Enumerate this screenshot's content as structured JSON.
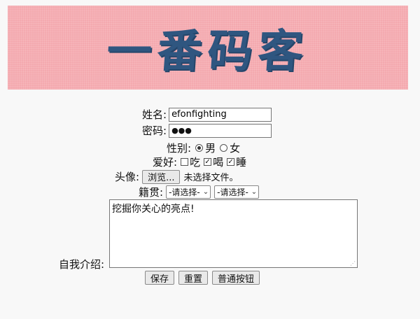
{
  "banner": {
    "title": "一番码客"
  },
  "form": {
    "name_label": "姓名:",
    "name_value": "efonfighting",
    "password_label": "密码:",
    "password_value": "●●●",
    "gender_label": "性别:",
    "gender_male": "男",
    "gender_female": "女",
    "hobby_label": "爱好:",
    "hobby_eat": "吃",
    "hobby_drink": "喝",
    "hobby_sleep": "睡",
    "avatar_label": "头像:",
    "browse_button": "浏览...",
    "no_file": "未选择文件。",
    "origin_label": "籍贯:",
    "select1": "-请选择-",
    "select2": "-请选择-",
    "intro_label": "自我介绍:",
    "intro_value": "挖掘你关心的亮点!",
    "save_button": "保存",
    "reset_button": "重置",
    "normal_button": "普通按钮"
  },
  "state": {
    "gender": "male",
    "hobbies_checked": [
      "喝",
      "睡"
    ],
    "hobbies_unchecked": [
      "吃"
    ]
  },
  "colors": {
    "banner_bg": "#f4a9af",
    "banner_text": "#2f5680"
  }
}
